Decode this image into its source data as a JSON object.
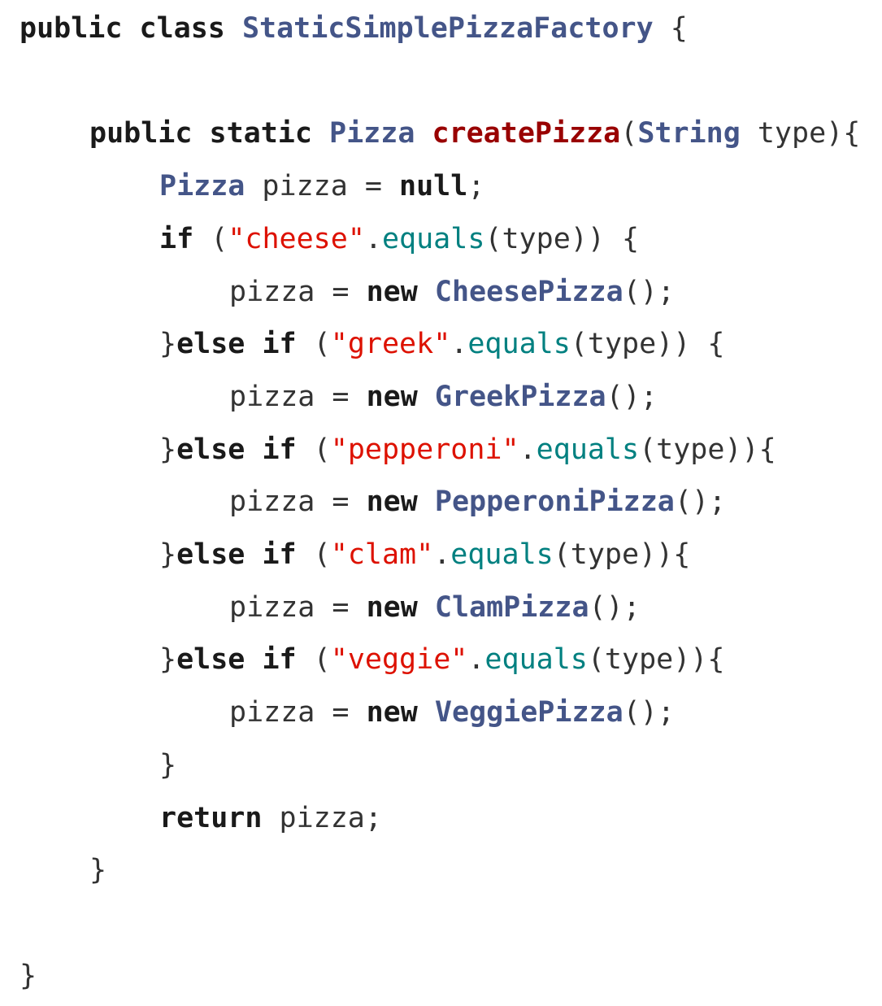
{
  "colors": {
    "keyword": "#1a1a1a",
    "type": "#445588",
    "method_def": "#990000",
    "string": "#dd1100",
    "call": "#008080",
    "plain": "#333333"
  },
  "code": {
    "lines": [
      {
        "indent": 0,
        "tokens": [
          {
            "t": "kw",
            "v": "public"
          },
          {
            "t": "plain",
            "v": " "
          },
          {
            "t": "kw",
            "v": "class"
          },
          {
            "t": "plain",
            "v": " "
          },
          {
            "t": "type",
            "v": "StaticSimplePizzaFactory"
          },
          {
            "t": "plain",
            "v": " {"
          }
        ]
      },
      {
        "indent": 0,
        "tokens": []
      },
      {
        "indent": 1,
        "tokens": [
          {
            "t": "kw",
            "v": "public"
          },
          {
            "t": "plain",
            "v": " "
          },
          {
            "t": "kw",
            "v": "static"
          },
          {
            "t": "plain",
            "v": " "
          },
          {
            "t": "type",
            "v": "Pizza"
          },
          {
            "t": "plain",
            "v": " "
          },
          {
            "t": "method_def",
            "v": "createPizza"
          },
          {
            "t": "plain",
            "v": "("
          },
          {
            "t": "type",
            "v": "String"
          },
          {
            "t": "plain",
            "v": " type){"
          }
        ]
      },
      {
        "indent": 2,
        "tokens": [
          {
            "t": "type",
            "v": "Pizza"
          },
          {
            "t": "plain",
            "v": " pizza = "
          },
          {
            "t": "kw",
            "v": "null"
          },
          {
            "t": "plain",
            "v": ";"
          }
        ]
      },
      {
        "indent": 2,
        "tokens": [
          {
            "t": "kw",
            "v": "if"
          },
          {
            "t": "plain",
            "v": " ("
          },
          {
            "t": "string",
            "v": "\"cheese\""
          },
          {
            "t": "plain",
            "v": "."
          },
          {
            "t": "call",
            "v": "equals"
          },
          {
            "t": "plain",
            "v": "(type)) {"
          }
        ]
      },
      {
        "indent": 3,
        "tokens": [
          {
            "t": "plain",
            "v": "pizza = "
          },
          {
            "t": "kw",
            "v": "new"
          },
          {
            "t": "plain",
            "v": " "
          },
          {
            "t": "type",
            "v": "CheesePizza"
          },
          {
            "t": "plain",
            "v": "();"
          }
        ]
      },
      {
        "indent": 2,
        "tokens": [
          {
            "t": "plain",
            "v": "}"
          },
          {
            "t": "kw",
            "v": "else"
          },
          {
            "t": "plain",
            "v": " "
          },
          {
            "t": "kw",
            "v": "if"
          },
          {
            "t": "plain",
            "v": " ("
          },
          {
            "t": "string",
            "v": "\"greek\""
          },
          {
            "t": "plain",
            "v": "."
          },
          {
            "t": "call",
            "v": "equals"
          },
          {
            "t": "plain",
            "v": "(type)) {"
          }
        ]
      },
      {
        "indent": 3,
        "tokens": [
          {
            "t": "plain",
            "v": "pizza = "
          },
          {
            "t": "kw",
            "v": "new"
          },
          {
            "t": "plain",
            "v": " "
          },
          {
            "t": "type",
            "v": "GreekPizza"
          },
          {
            "t": "plain",
            "v": "();"
          }
        ]
      },
      {
        "indent": 2,
        "tokens": [
          {
            "t": "plain",
            "v": "}"
          },
          {
            "t": "kw",
            "v": "else"
          },
          {
            "t": "plain",
            "v": " "
          },
          {
            "t": "kw",
            "v": "if"
          },
          {
            "t": "plain",
            "v": " ("
          },
          {
            "t": "string",
            "v": "\"pepperoni\""
          },
          {
            "t": "plain",
            "v": "."
          },
          {
            "t": "call",
            "v": "equals"
          },
          {
            "t": "plain",
            "v": "(type)){"
          }
        ]
      },
      {
        "indent": 3,
        "tokens": [
          {
            "t": "plain",
            "v": "pizza = "
          },
          {
            "t": "kw",
            "v": "new"
          },
          {
            "t": "plain",
            "v": " "
          },
          {
            "t": "type",
            "v": "PepperoniPizza"
          },
          {
            "t": "plain",
            "v": "();"
          }
        ]
      },
      {
        "indent": 2,
        "tokens": [
          {
            "t": "plain",
            "v": "}"
          },
          {
            "t": "kw",
            "v": "else"
          },
          {
            "t": "plain",
            "v": " "
          },
          {
            "t": "kw",
            "v": "if"
          },
          {
            "t": "plain",
            "v": " ("
          },
          {
            "t": "string",
            "v": "\"clam\""
          },
          {
            "t": "plain",
            "v": "."
          },
          {
            "t": "call",
            "v": "equals"
          },
          {
            "t": "plain",
            "v": "(type)){"
          }
        ]
      },
      {
        "indent": 3,
        "tokens": [
          {
            "t": "plain",
            "v": "pizza = "
          },
          {
            "t": "kw",
            "v": "new"
          },
          {
            "t": "plain",
            "v": " "
          },
          {
            "t": "type",
            "v": "ClamPizza"
          },
          {
            "t": "plain",
            "v": "();"
          }
        ]
      },
      {
        "indent": 2,
        "tokens": [
          {
            "t": "plain",
            "v": "}"
          },
          {
            "t": "kw",
            "v": "else"
          },
          {
            "t": "plain",
            "v": " "
          },
          {
            "t": "kw",
            "v": "if"
          },
          {
            "t": "plain",
            "v": " ("
          },
          {
            "t": "string",
            "v": "\"veggie\""
          },
          {
            "t": "plain",
            "v": "."
          },
          {
            "t": "call",
            "v": "equals"
          },
          {
            "t": "plain",
            "v": "(type)){"
          }
        ]
      },
      {
        "indent": 3,
        "tokens": [
          {
            "t": "plain",
            "v": "pizza = "
          },
          {
            "t": "kw",
            "v": "new"
          },
          {
            "t": "plain",
            "v": " "
          },
          {
            "t": "type",
            "v": "VeggiePizza"
          },
          {
            "t": "plain",
            "v": "();"
          }
        ]
      },
      {
        "indent": 2,
        "tokens": [
          {
            "t": "plain",
            "v": "}"
          }
        ]
      },
      {
        "indent": 2,
        "tokens": [
          {
            "t": "kw",
            "v": "return"
          },
          {
            "t": "plain",
            "v": " pizza;"
          }
        ]
      },
      {
        "indent": 1,
        "tokens": [
          {
            "t": "plain",
            "v": "}"
          }
        ]
      },
      {
        "indent": 0,
        "tokens": []
      },
      {
        "indent": 0,
        "tokens": [
          {
            "t": "plain",
            "v": "}"
          }
        ]
      }
    ]
  }
}
